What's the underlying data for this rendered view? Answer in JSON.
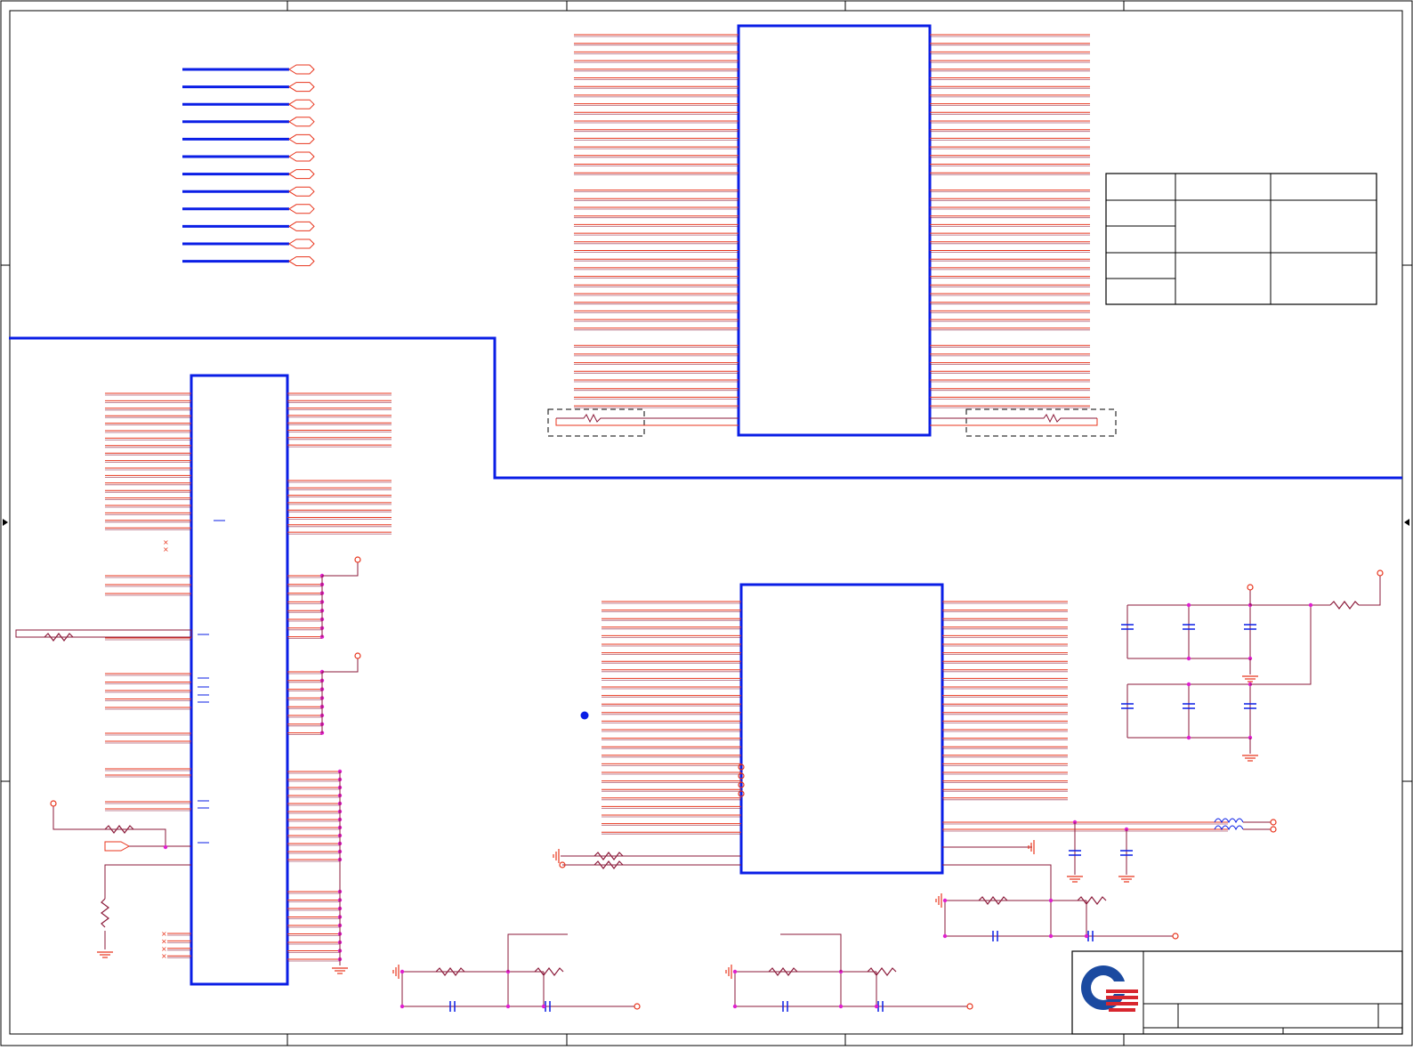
{
  "sheet": {
    "title": "",
    "logo": "quanta-logo",
    "colors": {
      "wire": "#e8341c",
      "net": "#8b1a3a",
      "bus": "#0a1ee6",
      "junction": "#e020d0",
      "frame": "#000000",
      "port": "#e8341c"
    }
  },
  "components": {
    "bus_ports_count_label": "",
    "chips": [
      {
        "id": "ram-chip-top",
        "label": ""
      },
      {
        "id": "controller-chip-left",
        "label": ""
      },
      {
        "id": "chip-bottom-middle",
        "label": ""
      }
    ]
  },
  "title_block": {
    "company": "",
    "document_title": "",
    "size_label": "",
    "rev_label": ""
  },
  "table": {
    "rows": [
      [
        "",
        "",
        ""
      ],
      [
        "",
        "",
        ""
      ],
      [
        "",
        "",
        ""
      ],
      [
        "",
        "",
        ""
      ],
      [
        "",
        "",
        ""
      ]
    ]
  }
}
